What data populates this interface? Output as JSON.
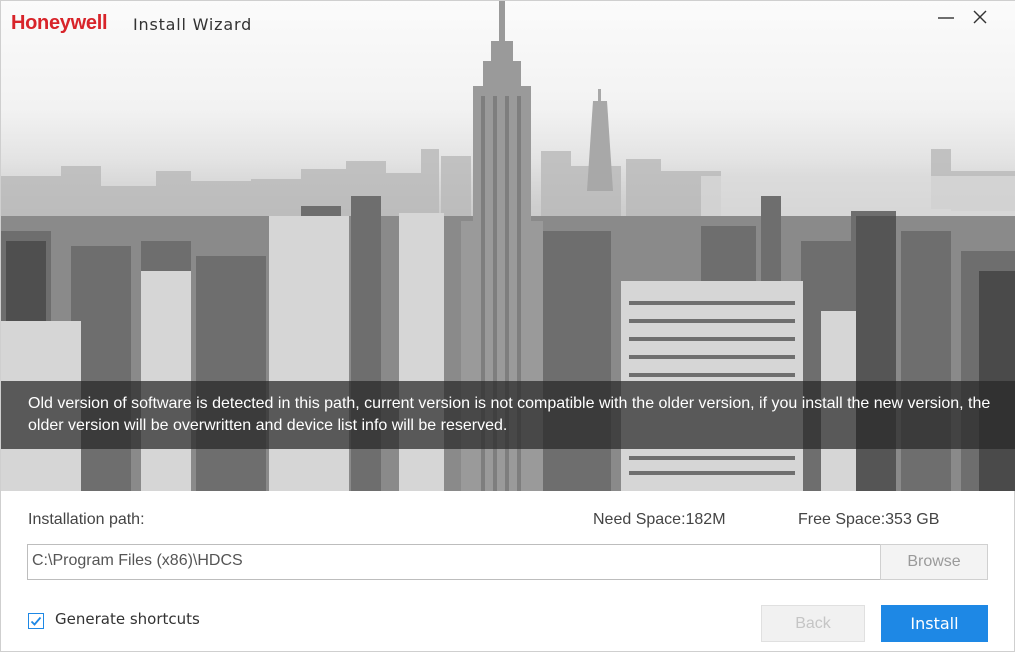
{
  "window": {
    "brand": "Honeywell",
    "title": "Install Wizard"
  },
  "notice": {
    "text": "Old version of software is detected in this path, current version is not compatible with the older version, if you install the new version, the older version will be overwritten and device list info will be reserved."
  },
  "install": {
    "path_label": "Installation path:",
    "need_space": "Need Space:182M",
    "free_space": "Free Space:353 GB",
    "path_value": "C:\\Program Files (x86)\\HDCS",
    "browse_label": "Browse"
  },
  "options": {
    "shortcuts_label": "Generate shortcuts",
    "shortcuts_checked": true
  },
  "actions": {
    "back_label": "Back",
    "install_label": "Install"
  },
  "colors": {
    "brand_red": "#d8242a",
    "accent_blue": "#1e88e5"
  },
  "icons": {
    "minimize": "minimize-icon",
    "close": "close-icon",
    "checkbox": "checkmark-icon"
  }
}
